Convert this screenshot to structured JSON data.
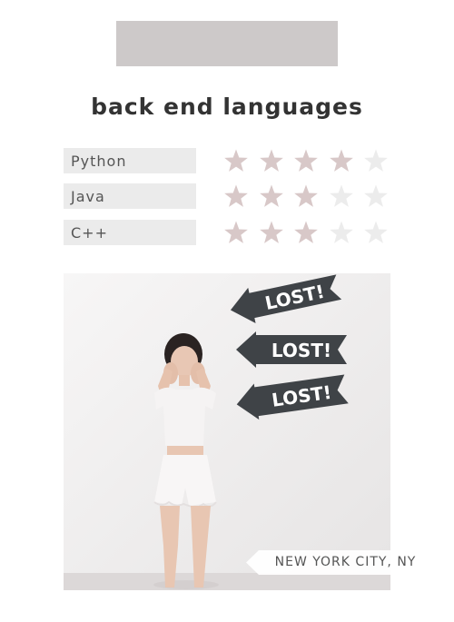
{
  "section": {
    "title": "back end languages"
  },
  "skills": [
    {
      "name": "Python",
      "rating": 4,
      "max": 5
    },
    {
      "name": "Java",
      "rating": 3,
      "max": 5
    },
    {
      "name": "C++",
      "rating": 3,
      "max": 5
    }
  ],
  "colors": {
    "header_bar": "#cdc9c9",
    "label_bg": "#ebebeb",
    "star_filled": "#d8c8c8",
    "star_empty": "#ececec",
    "title_text": "#333333"
  },
  "photo": {
    "signs": [
      "LOST!",
      "LOST!",
      "LOST!"
    ],
    "location": "NEW YORK CITY, NY"
  }
}
